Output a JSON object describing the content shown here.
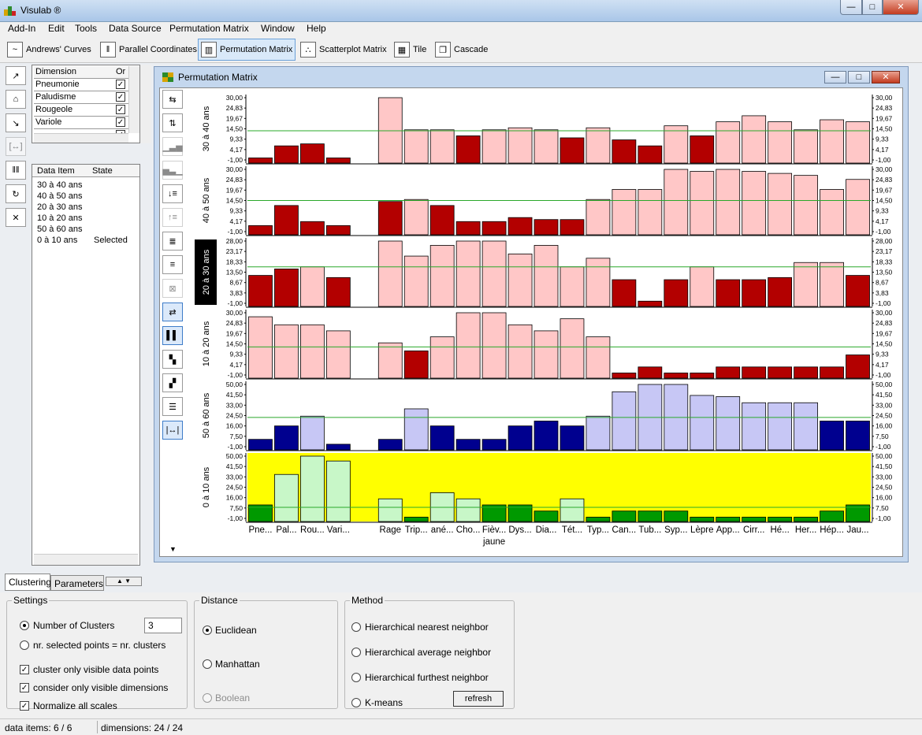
{
  "window": {
    "title": "Visulab ®",
    "min": "—",
    "max": "□",
    "close": "✕"
  },
  "menu": [
    "Add-In",
    "Edit",
    "Tools",
    "Data Source",
    "Permutation Matrix",
    "Window",
    "Help"
  ],
  "toolbar": [
    {
      "label": "Andrews' Curves",
      "icon": "andrews-curves-icon"
    },
    {
      "label": "Parallel Coordinates",
      "icon": "parallel-coordinates-icon"
    },
    {
      "label": "Permutation Matrix",
      "icon": "permutation-matrix-icon",
      "active": true
    },
    {
      "label": "Scatterplot Matrix",
      "icon": "scatterplot-matrix-icon"
    },
    {
      "label": "Tile",
      "icon": "tile-icon"
    },
    {
      "label": "Cascade",
      "icon": "cascade-icon"
    }
  ],
  "dimensions": {
    "header": "Dimension",
    "header2": "Or",
    "items": [
      "Pneumonie",
      "Paludisme",
      "Rougeole",
      "Variole",
      ""
    ]
  },
  "dataitems": {
    "header": "Data Item",
    "header2": "State",
    "items": [
      {
        "name": "30 à 40 ans",
        "state": ""
      },
      {
        "name": "40 à 50 ans",
        "state": ""
      },
      {
        "name": "20 à 30 ans",
        "state": ""
      },
      {
        "name": "10 à 20 ans",
        "state": ""
      },
      {
        "name": "50 à 60 ans",
        "state": ""
      },
      {
        "name": "0 à 10 ans",
        "state": "Selected"
      }
    ]
  },
  "matrix": {
    "title": "Permutation Matrix",
    "minimize": "—",
    "maximize": "□",
    "close": "✕"
  },
  "chart_data": {
    "type": "bar",
    "categories": [
      "Pne...",
      "Pal...",
      "Rou...",
      "Vari...",
      "",
      "Rage",
      "Trip...",
      "ané...",
      "Cho...",
      "Fièv...",
      "Dys...",
      "Dia...",
      "Tét...",
      "Typ...",
      "Can...",
      "Tub...",
      "Syp...",
      "Lèpre",
      "App...",
      "Cirr...",
      "Hé...",
      "Her...",
      "Hép...",
      "Jau..."
    ],
    "extra_label": "jaune",
    "rows": [
      {
        "name": "30 à 40 ans",
        "ticks": [
          "30,00",
          "24,83",
          "19,67",
          "14,50",
          "9,33",
          "4,17",
          "-1,00"
        ],
        "min": -1,
        "max": 30,
        "mean": 13.5,
        "values": [
          0,
          6,
          7,
          0,
          -1,
          30,
          14,
          14,
          11,
          14,
          15,
          14,
          10,
          15,
          9,
          6,
          16,
          11,
          18,
          21,
          18,
          14,
          19,
          18
        ],
        "dark": [
          1,
          1,
          1,
          1,
          0,
          0,
          0,
          0,
          1,
          0,
          0,
          0,
          1,
          0,
          1,
          1,
          0,
          1,
          0,
          0,
          0,
          0,
          0,
          0
        ]
      },
      {
        "name": "40 à 50 ans",
        "ticks": [
          "30,00",
          "24,83",
          "19,67",
          "14,50",
          "9,33",
          "4,17",
          "-1,00"
        ],
        "min": -1,
        "max": 30,
        "mean": 14.5,
        "values": [
          2,
          12,
          4,
          2,
          -1,
          14,
          15,
          12,
          4,
          4,
          6,
          5,
          5,
          15,
          20,
          20,
          30,
          29,
          30,
          29,
          28,
          27,
          20,
          25
        ],
        "dark": [
          1,
          1,
          1,
          1,
          0,
          1,
          0,
          1,
          1,
          1,
          1,
          1,
          1,
          0,
          0,
          0,
          0,
          0,
          0,
          0,
          0,
          0,
          0,
          0
        ]
      },
      {
        "name": "20 à 30 ans",
        "ticks": [
          "28,00",
          "23,17",
          "18,33",
          "13,50",
          "8,67",
          "3,83",
          "-1,00"
        ],
        "min": -1,
        "max": 28,
        "mean": 16,
        "values": [
          12,
          15,
          16,
          11,
          -1,
          28,
          21,
          26,
          28,
          28,
          22,
          26,
          16,
          20,
          10,
          0,
          10,
          16,
          10,
          10,
          11,
          18,
          18,
          12
        ],
        "dark": [
          1,
          1,
          0,
          1,
          0,
          0,
          0,
          0,
          0,
          0,
          0,
          0,
          0,
          0,
          1,
          1,
          1,
          0,
          1,
          1,
          1,
          0,
          0,
          1
        ],
        "highlight": true
      },
      {
        "name": "10 à 20 ans",
        "ticks": [
          "30,00",
          "24,83",
          "19,67",
          "14,50",
          "9,33",
          "4,17",
          "-1,00"
        ],
        "min": -1,
        "max": 30,
        "mean": 13,
        "values": [
          28,
          24,
          24,
          21,
          -1,
          15,
          11,
          18,
          30,
          30,
          24,
          21,
          27,
          18,
          0,
          3,
          0,
          0,
          3,
          3,
          3,
          3,
          3,
          9
        ],
        "dark": [
          0,
          0,
          0,
          0,
          0,
          0,
          1,
          0,
          0,
          0,
          0,
          0,
          0,
          0,
          1,
          1,
          1,
          1,
          1,
          1,
          1,
          1,
          1,
          1
        ]
      },
      {
        "name": "50 à 60 ans",
        "ticks": [
          "50,00",
          "41,50",
          "33,00",
          "24,50",
          "16,00",
          "7,50",
          "-1,00"
        ],
        "min": -1,
        "max": 50,
        "mean": 23,
        "values": [
          5,
          16,
          24,
          1,
          -1,
          5,
          30,
          16,
          5,
          5,
          16,
          20,
          16,
          24,
          44,
          50,
          50,
          41,
          40,
          35,
          35,
          35,
          20,
          20
        ],
        "dark": [
          1,
          1,
          0,
          1,
          0,
          1,
          0,
          1,
          1,
          1,
          1,
          1,
          1,
          0,
          0,
          0,
          0,
          0,
          0,
          0,
          0,
          0,
          1,
          1
        ]
      },
      {
        "name": "0 à 10 ans",
        "ticks": [
          "50,00",
          "41,50",
          "33,00",
          "24,50",
          "16,00",
          "7,50",
          "-1,00"
        ],
        "min": -1,
        "max": 50,
        "mean": 8,
        "values": [
          10,
          35,
          50,
          46,
          -1,
          15,
          0,
          20,
          15,
          10,
          10,
          5,
          15,
          0,
          5,
          5,
          5,
          0,
          0,
          0,
          0,
          0,
          5,
          10
        ],
        "dark": [
          1,
          0,
          0,
          0,
          0,
          0,
          1,
          0,
          0,
          1,
          1,
          1,
          0,
          1,
          1,
          1,
          1,
          1,
          1,
          1,
          1,
          1,
          1,
          1
        ],
        "selected": true
      }
    ]
  },
  "tabs": [
    "Clustering",
    "Parameters"
  ],
  "settings": {
    "label": "Settings",
    "numclusters_label": "Number of Clusters",
    "numclusters": "3",
    "nrselected": "nr. selected points = nr. clusters",
    "c1": "cluster only visible data points",
    "c2": "consider only visible dimensions",
    "c3": "Normalize all scales"
  },
  "distance": {
    "label": "Distance",
    "o1": "Euclidean",
    "o2": "Manhattan",
    "o3": "Boolean"
  },
  "method": {
    "label": "Method",
    "o1": "Hierarchical nearest neighbor",
    "o2": "Hierarchical average neighbor",
    "o3": "Hierarchical furthest neighbor",
    "o4": "K-means",
    "refresh": "refresh"
  },
  "status": {
    "items": "data items: 6 / 6",
    "dims": "dimensions: 24 / 24"
  }
}
